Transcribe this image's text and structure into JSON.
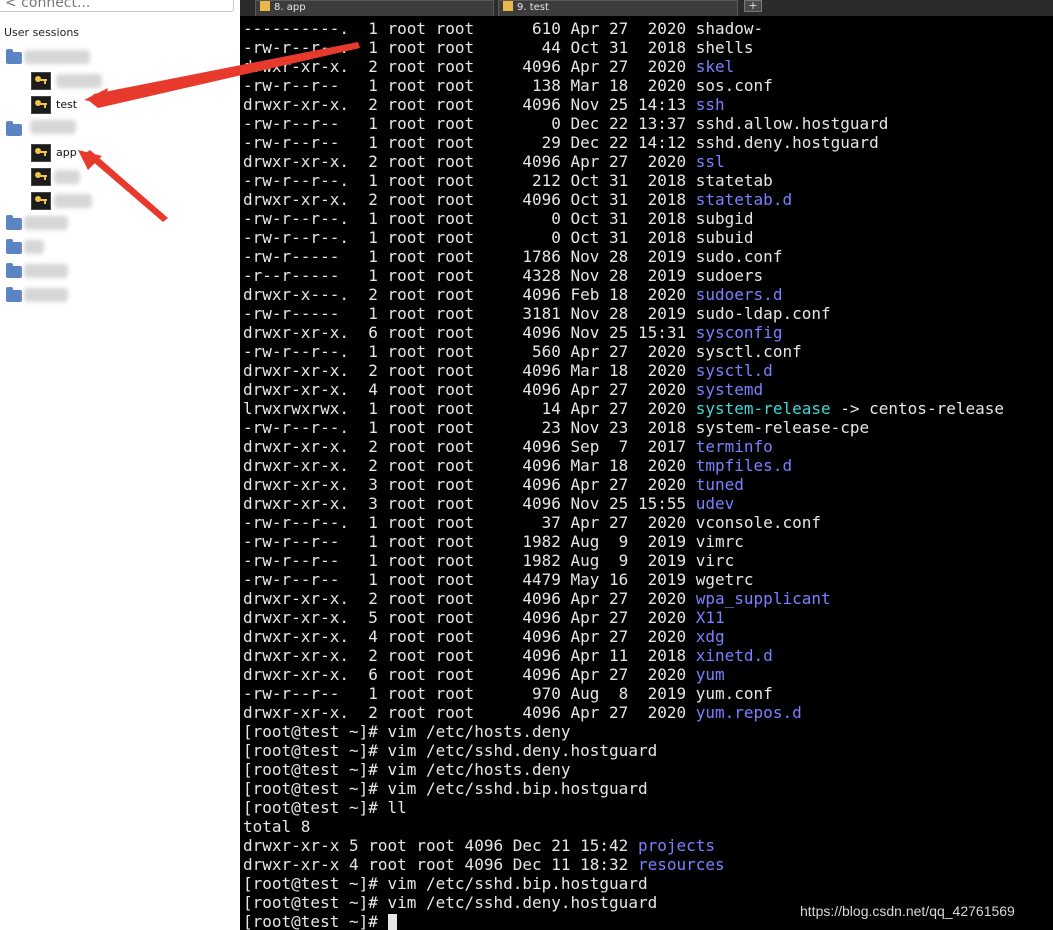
{
  "sidebar": {
    "search_placeholder": "< connect...",
    "sessions_label": "User sessions",
    "sessions": [
      {
        "label": "test",
        "icon": "key-icon"
      },
      {
        "label": "app",
        "icon": "key-icon"
      }
    ]
  },
  "tabs": [
    {
      "label": "8. app"
    },
    {
      "label": "9. test"
    }
  ],
  "add_tab_label": "+",
  "colors": {
    "directory": "#7a80ff",
    "symlink": "#40d8d8",
    "text": "#e6e6e6",
    "arrow": "#e8392d"
  },
  "terminal": {
    "lines": [
      {
        "prefix": "----------.  1 root root      610 Apr 27  2020 ",
        "name": "shadow-",
        "type": "file"
      },
      {
        "prefix": "-rw-r--r--.  1 root root       44 Oct 31  2018 ",
        "name": "shells",
        "type": "file"
      },
      {
        "prefix": "drwxr-xr-x.  2 root root     4096 Apr 27  2020 ",
        "name": "skel",
        "type": "dir"
      },
      {
        "prefix": "-rw-r--r--   1 root root      138 Mar 18  2020 ",
        "name": "sos.conf",
        "type": "file"
      },
      {
        "prefix": "drwxr-xr-x.  2 root root     4096 Nov 25 14:13 ",
        "name": "ssh",
        "type": "dir"
      },
      {
        "prefix": "-rw-r--r--   1 root root        0 Dec 22 13:37 ",
        "name": "sshd.allow.hostguard",
        "type": "file"
      },
      {
        "prefix": "-rw-r--r--   1 root root       29 Dec 22 14:12 ",
        "name": "sshd.deny.hostguard",
        "type": "file"
      },
      {
        "prefix": "drwxr-xr-x.  2 root root     4096 Apr 27  2020 ",
        "name": "ssl",
        "type": "dir"
      },
      {
        "prefix": "-rw-r--r--.  1 root root      212 Oct 31  2018 ",
        "name": "statetab",
        "type": "file"
      },
      {
        "prefix": "drwxr-xr-x.  2 root root     4096 Oct 31  2018 ",
        "name": "statetab.d",
        "type": "dir"
      },
      {
        "prefix": "-rw-r--r--.  1 root root        0 Oct 31  2018 ",
        "name": "subgid",
        "type": "file"
      },
      {
        "prefix": "-rw-r--r--.  1 root root        0 Oct 31  2018 ",
        "name": "subuid",
        "type": "file"
      },
      {
        "prefix": "-rw-r-----   1 root root     1786 Nov 28  2019 ",
        "name": "sudo.conf",
        "type": "file"
      },
      {
        "prefix": "-r--r-----   1 root root     4328 Nov 28  2019 ",
        "name": "sudoers",
        "type": "file"
      },
      {
        "prefix": "drwxr-x---.  2 root root     4096 Feb 18  2020 ",
        "name": "sudoers.d",
        "type": "dir"
      },
      {
        "prefix": "-rw-r-----   1 root root     3181 Nov 28  2019 ",
        "name": "sudo-ldap.conf",
        "type": "file"
      },
      {
        "prefix": "drwxr-xr-x.  6 root root     4096 Nov 25 15:31 ",
        "name": "sysconfig",
        "type": "dir"
      },
      {
        "prefix": "-rw-r--r--.  1 root root      560 Apr 27  2020 ",
        "name": "sysctl.conf",
        "type": "file"
      },
      {
        "prefix": "drwxr-xr-x.  2 root root     4096 Mar 18  2020 ",
        "name": "sysctl.d",
        "type": "dir"
      },
      {
        "prefix": "drwxr-xr-x.  4 root root     4096 Apr 27  2020 ",
        "name": "systemd",
        "type": "dir"
      },
      {
        "prefix": "lrwxrwxrwx.  1 root root       14 Apr 27  2020 ",
        "name": "system-release",
        "type": "link",
        "suffix": " -> centos-release"
      },
      {
        "prefix": "-rw-r--r--.  1 root root       23 Nov 23  2018 ",
        "name": "system-release-cpe",
        "type": "file"
      },
      {
        "prefix": "drwxr-xr-x.  2 root root     4096 Sep  7  2017 ",
        "name": "terminfo",
        "type": "dir"
      },
      {
        "prefix": "drwxr-xr-x.  2 root root     4096 Mar 18  2020 ",
        "name": "tmpfiles.d",
        "type": "dir"
      },
      {
        "prefix": "drwxr-xr-x.  3 root root     4096 Apr 27  2020 ",
        "name": "tuned",
        "type": "dir"
      },
      {
        "prefix": "drwxr-xr-x.  3 root root     4096 Nov 25 15:55 ",
        "name": "udev",
        "type": "dir"
      },
      {
        "prefix": "-rw-r--r--.  1 root root       37 Apr 27  2020 ",
        "name": "vconsole.conf",
        "type": "file"
      },
      {
        "prefix": "-rw-r--r--   1 root root     1982 Aug  9  2019 ",
        "name": "vimrc",
        "type": "file"
      },
      {
        "prefix": "-rw-r--r--   1 root root     1982 Aug  9  2019 ",
        "name": "virc",
        "type": "file"
      },
      {
        "prefix": "-rw-r--r--   1 root root     4479 May 16  2019 ",
        "name": "wgetrc",
        "type": "file"
      },
      {
        "prefix": "drwxr-xr-x.  2 root root     4096 Apr 27  2020 ",
        "name": "wpa_supplicant",
        "type": "dir"
      },
      {
        "prefix": "drwxr-xr-x.  5 root root     4096 Apr 27  2020 ",
        "name": "X11",
        "type": "dir"
      },
      {
        "prefix": "drwxr-xr-x.  4 root root     4096 Apr 27  2020 ",
        "name": "xdg",
        "type": "dir"
      },
      {
        "prefix": "drwxr-xr-x.  2 root root     4096 Apr 11  2018 ",
        "name": "xinetd.d",
        "type": "dir"
      },
      {
        "prefix": "drwxr-xr-x.  6 root root     4096 Apr 27  2020 ",
        "name": "yum",
        "type": "dir"
      },
      {
        "prefix": "-rw-r--r--   1 root root      970 Aug  8  2019 ",
        "name": "yum.conf",
        "type": "file"
      },
      {
        "prefix": "drwxr-xr-x.  2 root root     4096 Apr 27  2020 ",
        "name": "yum.repos.d",
        "type": "dir"
      },
      {
        "prefix": "[root@test ~]# vim /etc/hosts.deny",
        "name": "",
        "type": "cmd"
      },
      {
        "prefix": "[root@test ~]# vim /etc/sshd.deny.hostguard",
        "name": "",
        "type": "cmd"
      },
      {
        "prefix": "[root@test ~]# vim /etc/hosts.deny",
        "name": "",
        "type": "cmd"
      },
      {
        "prefix": "[root@test ~]# vim /etc/sshd.bip.hostguard",
        "name": "",
        "type": "cmd"
      },
      {
        "prefix": "[root@test ~]# ll",
        "name": "",
        "type": "cmd"
      },
      {
        "prefix": "total 8",
        "name": "",
        "type": "cmd"
      },
      {
        "prefix": "drwxr-xr-x 5 root root 4096 Dec 21 15:42 ",
        "name": "projects",
        "type": "dir"
      },
      {
        "prefix": "drwxr-xr-x 4 root root 4096 Dec 11 18:32 ",
        "name": "resources",
        "type": "dir"
      },
      {
        "prefix": "[root@test ~]# vim /etc/sshd.bip.hostguard",
        "name": "",
        "type": "cmd"
      },
      {
        "prefix": "[root@test ~]# vim /etc/sshd.deny.hostguard",
        "name": "",
        "type": "cmd"
      },
      {
        "prefix": "[root@test ~]# ",
        "name": "",
        "type": "prompt"
      }
    ]
  },
  "watermark": "https://blog.csdn.net/qq_42761569"
}
